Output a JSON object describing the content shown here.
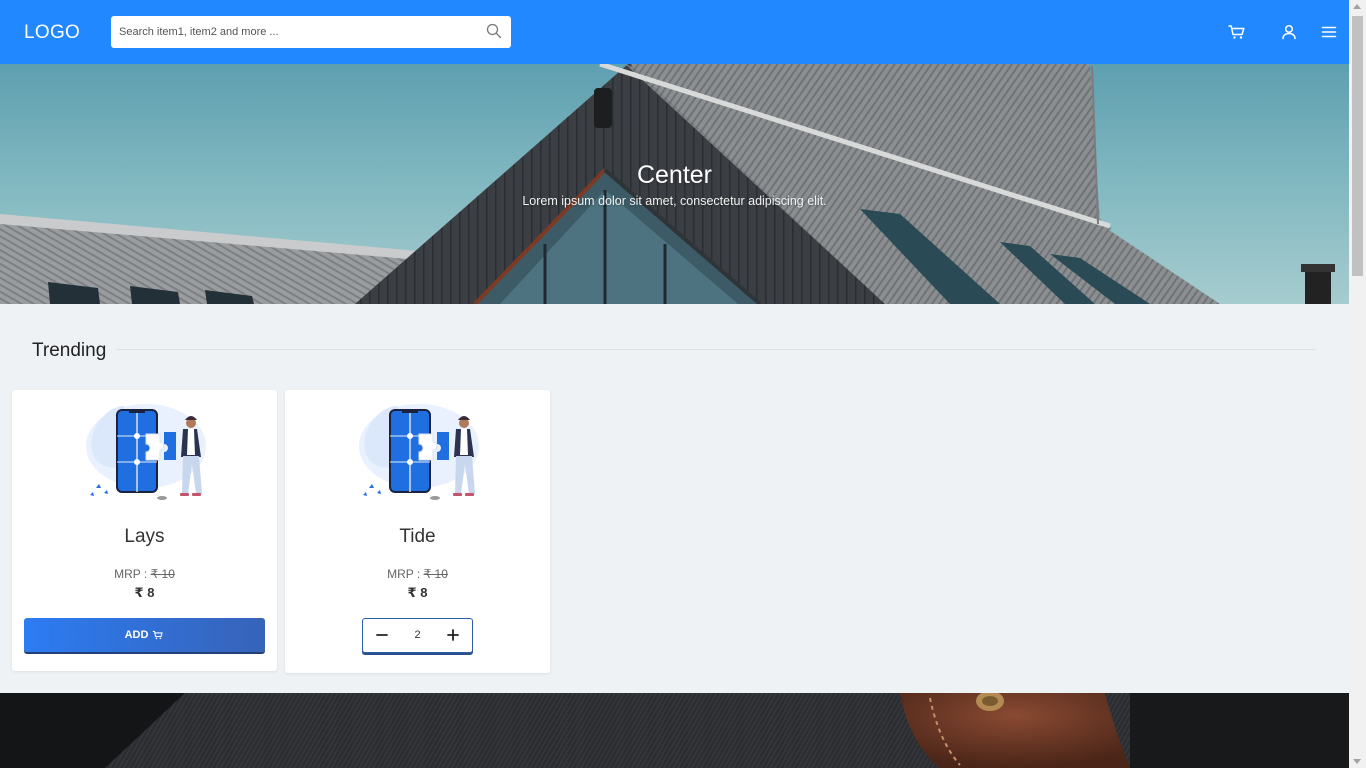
{
  "header": {
    "logo": "LOGO",
    "search_placeholder": "Search item1, item2 and more ...",
    "brand_color": "#2188ff",
    "icons": [
      "search-icon",
      "cart-icon",
      "user-icon",
      "menu-icon"
    ]
  },
  "hero": {
    "title": "Center",
    "subtitle": "Lorem ipsum dolor sit amet, consectetur adipiscing elit."
  },
  "section": {
    "title": "Trending"
  },
  "products": [
    {
      "name": "Lays",
      "mrp_label": "MRP : ",
      "mrp": "₹ 10",
      "price": "₹ 8",
      "add_label": "ADD",
      "in_cart": false
    },
    {
      "name": "Tide",
      "mrp_label": "MRP : ",
      "mrp": "₹ 10",
      "price": "₹ 8",
      "quantity": "2",
      "in_cart": true
    }
  ]
}
